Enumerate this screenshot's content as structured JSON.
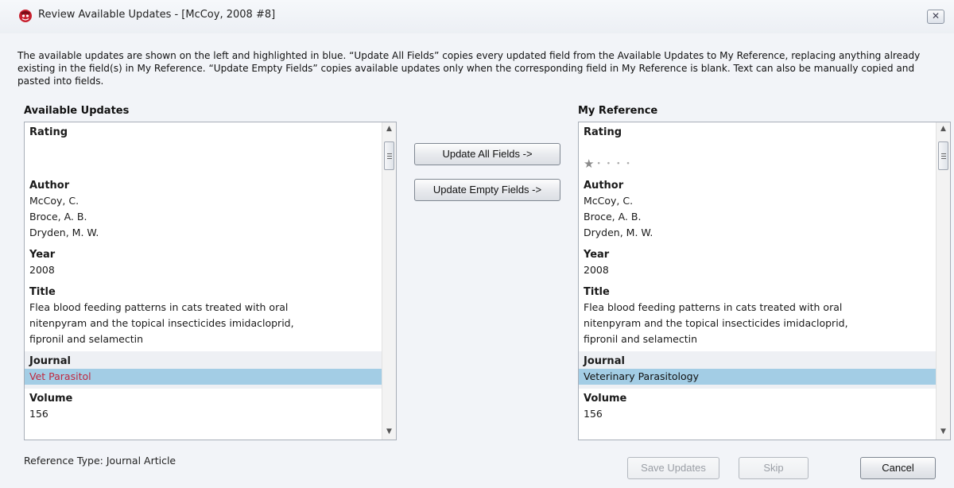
{
  "window": {
    "title": "Review Available Updates - [McCoy, 2008 #8]",
    "close_label": "✕"
  },
  "instructions": "The available updates are shown on the left and highlighted in blue. “Update All Fields” copies every updated field from the Available Updates to My Reference, replacing anything already existing in the field(s) in My Reference. “Update Empty Fields” copies available updates only when the corresponding field in My Reference is blank. Text can also be manually copied and pasted into fields.",
  "available_updates": {
    "heading": "Available Updates",
    "fields": [
      {
        "label": "Rating",
        "value": ""
      },
      {
        "label": "Author",
        "value": "McCoy, C.\nBroce, A. B.\nDryden, M. W."
      },
      {
        "label": "Year",
        "value": "2008"
      },
      {
        "label": "Title",
        "value": "Flea blood feeding patterns in cats treated with oral\nnitenpyram and the topical insecticides imidacloprid,\nfipronil and selamectin"
      },
      {
        "label": "Journal",
        "value": "Vet Parasitol"
      },
      {
        "label": "Volume",
        "value": "156"
      }
    ]
  },
  "my_reference": {
    "heading": "My Reference",
    "rating": {
      "value": 1,
      "max": 5
    },
    "fields": [
      {
        "label": "Rating",
        "value": ""
      },
      {
        "label": "Author",
        "value": "McCoy, C.\nBroce, A. B.\nDryden, M. W."
      },
      {
        "label": "Year",
        "value": "2008"
      },
      {
        "label": "Title",
        "value": "Flea blood feeding patterns in cats treated with oral\nnitenpyram and the topical insecticides imidacloprid,\nfipronil and selamectin"
      },
      {
        "label": "Journal",
        "value": "Veterinary Parasitology"
      },
      {
        "label": "Volume",
        "value": "156"
      }
    ]
  },
  "actions": {
    "update_all": "Update All Fields ->",
    "update_empty": "Update Empty Fields ->"
  },
  "footer": {
    "reference_type": "Reference Type: Journal Article",
    "save_updates": "Save Updates",
    "skip": "Skip",
    "cancel": "Cancel"
  },
  "icons": {
    "app": "endnote-app-icon",
    "close": "close-icon",
    "star": "star-icon",
    "scroll_up": "scroll-up-arrow-icon",
    "scroll_down": "scroll-down-arrow-icon"
  },
  "colors": {
    "highlight": "#a3cde5",
    "updated_text": "#c0283f"
  }
}
